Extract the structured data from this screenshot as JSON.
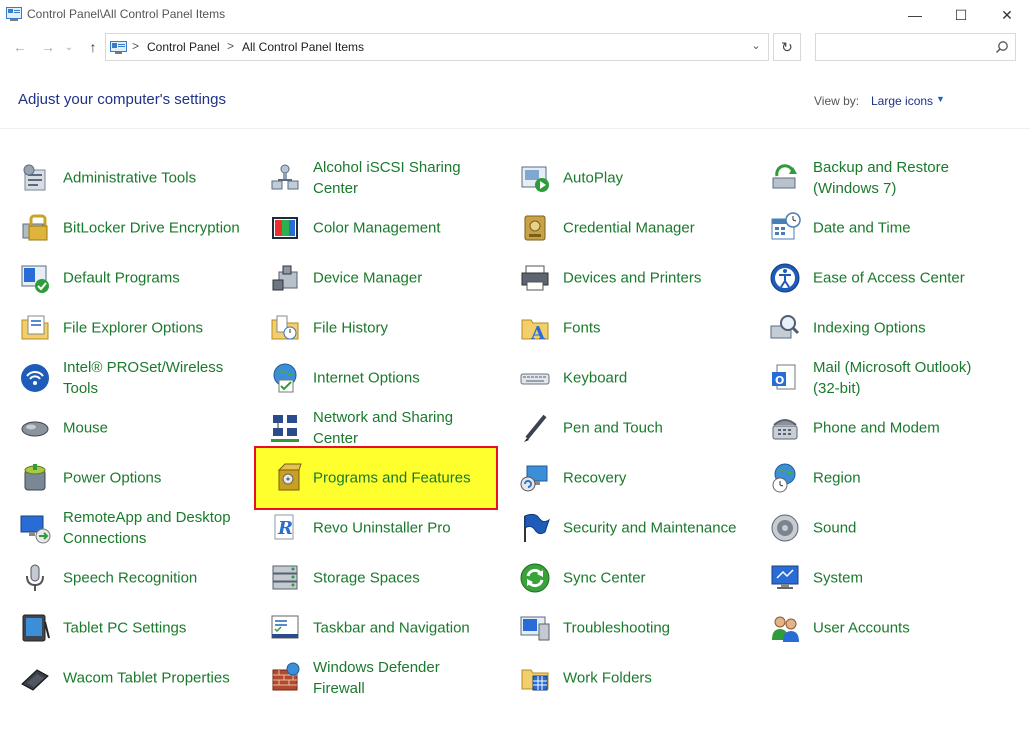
{
  "window": {
    "title": "Control Panel\\All Control Panel Items",
    "min_glyph": "—",
    "max_glyph": "☐",
    "close_glyph": "✕"
  },
  "nav": {
    "back_glyph": "←",
    "forward_glyph": "→",
    "recent_glyph": "⌄",
    "up_glyph": "↑",
    "breadcrumb": [
      "Control Panel",
      "All Control Panel Items"
    ],
    "sep_glyph": ">",
    "dropdown_glyph": "⌄",
    "refresh_glyph": "↻",
    "search_placeholder": "",
    "search_value": ""
  },
  "header": {
    "heading": "Adjust your computer's settings",
    "view_by_label": "View by:",
    "view_by_value": "Large icons",
    "view_by_arrow": "▼"
  },
  "items": [
    {
      "label": "Administrative Tools",
      "icon": "admin-tools-icon"
    },
    {
      "label": "Alcohol iSCSI Sharing Center",
      "icon": "iscsi-icon"
    },
    {
      "label": "AutoPlay",
      "icon": "autoplay-icon"
    },
    {
      "label": "Backup and Restore (Windows 7)",
      "icon": "backup-icon"
    },
    {
      "label": "BitLocker Drive Encryption",
      "icon": "bitlocker-icon"
    },
    {
      "label": "Color Management",
      "icon": "color-management-icon"
    },
    {
      "label": "Credential Manager",
      "icon": "credential-icon"
    },
    {
      "label": "Date and Time",
      "icon": "calendar-clock-icon"
    },
    {
      "label": "Default Programs",
      "icon": "default-programs-icon"
    },
    {
      "label": "Device Manager",
      "icon": "device-manager-icon"
    },
    {
      "label": "Devices and Printers",
      "icon": "printer-icon"
    },
    {
      "label": "Ease of Access Center",
      "icon": "ease-of-access-icon"
    },
    {
      "label": "File Explorer Options",
      "icon": "folder-options-icon"
    },
    {
      "label": "File History",
      "icon": "file-history-icon"
    },
    {
      "label": "Fonts",
      "icon": "fonts-icon"
    },
    {
      "label": "Indexing Options",
      "icon": "indexing-icon"
    },
    {
      "label": "Intel® PROSet/Wireless Tools",
      "icon": "wireless-icon"
    },
    {
      "label": "Internet Options",
      "icon": "internet-options-icon"
    },
    {
      "label": "Keyboard",
      "icon": "keyboard-icon"
    },
    {
      "label": "Mail (Microsoft Outlook) (32-bit)",
      "icon": "mail-icon"
    },
    {
      "label": "Mouse",
      "icon": "mouse-icon"
    },
    {
      "label": "Network and Sharing Center",
      "icon": "network-icon"
    },
    {
      "label": "Pen and Touch",
      "icon": "pen-icon"
    },
    {
      "label": "Phone and Modem",
      "icon": "phone-icon"
    },
    {
      "label": "Power Options",
      "icon": "power-icon"
    },
    {
      "label": "Programs and Features",
      "icon": "programs-icon",
      "highlighted": true
    },
    {
      "label": "Recovery",
      "icon": "recovery-icon"
    },
    {
      "label": "Region",
      "icon": "region-icon"
    },
    {
      "label": "RemoteApp and Desktop Connections",
      "icon": "remoteapp-icon"
    },
    {
      "label": "Revo Uninstaller Pro",
      "icon": "revo-icon"
    },
    {
      "label": "Security and Maintenance",
      "icon": "flag-icon"
    },
    {
      "label": "Sound",
      "icon": "speaker-icon"
    },
    {
      "label": "Speech Recognition",
      "icon": "microphone-icon"
    },
    {
      "label": "Storage Spaces",
      "icon": "storage-icon"
    },
    {
      "label": "Sync Center",
      "icon": "sync-icon"
    },
    {
      "label": "System",
      "icon": "system-icon"
    },
    {
      "label": "Tablet PC Settings",
      "icon": "tablet-icon"
    },
    {
      "label": "Taskbar and Navigation",
      "icon": "taskbar-icon"
    },
    {
      "label": "Troubleshooting",
      "icon": "troubleshoot-icon"
    },
    {
      "label": "User Accounts",
      "icon": "users-icon"
    },
    {
      "label": "Wacom Tablet Properties",
      "icon": "wacom-icon"
    },
    {
      "label": "Windows Defender Firewall",
      "icon": "firewall-icon"
    },
    {
      "label": "Work Folders",
      "icon": "work-folders-icon"
    }
  ],
  "colors": {
    "item_text": "#1a7a2c",
    "heading": "#1e3287",
    "highlight_bg": "#ffff2e",
    "highlight_border": "#e81123"
  }
}
